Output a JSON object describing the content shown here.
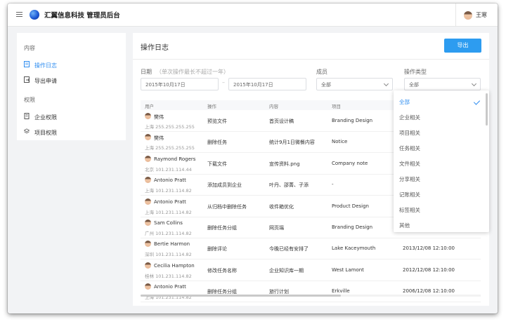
{
  "header": {
    "title": "汇翼信息科技 管理员后台",
    "user_name": "王寒",
    "menu_icon": "hamburger-icon",
    "logo": "globe-logo"
  },
  "sidebar": {
    "section_content": "内容",
    "section_permission": "权限",
    "items": [
      {
        "label": "操作日志",
        "icon": "document-icon",
        "active": true
      },
      {
        "label": "导出申请",
        "icon": "export-icon",
        "active": false
      },
      {
        "label": "企业权限",
        "icon": "building-icon",
        "active": false
      },
      {
        "label": "项目权限",
        "icon": "layers-icon",
        "active": false
      }
    ]
  },
  "main": {
    "title": "操作日志",
    "export_label": "导出"
  },
  "filters": {
    "date_label": "日期",
    "date_hint": "（单次操作最长不超过一年）",
    "date_start": "2015年10月17日",
    "date_separator": "–",
    "date_end": "2015年10月17日",
    "member_label": "成员",
    "member_value": "全部",
    "optype_label": "操作类型",
    "optype_value": "全部"
  },
  "table": {
    "columns": [
      "用户",
      "操作",
      "内容",
      "项目"
    ],
    "rows": [
      {
        "name": "樊伟",
        "location": "上海 255.255.255.255",
        "action": "预览文件",
        "content": "首页设计稿",
        "project": "Branding Design",
        "time": ""
      },
      {
        "name": "樊伟",
        "location": "上海 255.255.255.255",
        "action": "删除任务",
        "content": "统计9月1日微餐内容",
        "project": "Notice",
        "time": ""
      },
      {
        "name": "Raymond Rogers",
        "location": "北京 101.231.114.44",
        "action": "下载文件",
        "content": "宣传资料.png",
        "project": "Company note",
        "time": ""
      },
      {
        "name": "Antonio Pratt",
        "location": "上海 101.231.114.82",
        "action": "添加成员到企业",
        "content": "叶丹、邵菁、子添",
        "project": "-",
        "time": ""
      },
      {
        "name": "Antonio Pratt",
        "location": "上海 101.231.114.82",
        "action": "从归档中删除任务",
        "content": "收件箱优化",
        "project": "Product Design",
        "time": ""
      },
      {
        "name": "Sam Collins",
        "location": "广州 101.231.114.82",
        "action": "删除任务分组",
        "content": "网页端",
        "project": "Branding Design",
        "time": ""
      },
      {
        "name": "Bertie Harmon",
        "location": "深圳 101.231.114.82",
        "action": "删除评论",
        "content": "今晚已经有安排了",
        "project": "Lake Kaceymouth",
        "time": "2013/12/08 12:10:00"
      },
      {
        "name": "Cecilia Hampton",
        "location": "桂林 101.231.114.82",
        "action": "修改任务名称",
        "content": "企业知识库一期",
        "project": "West Lamont",
        "time": "2012/12/08 12:10:00"
      },
      {
        "name": "Antonio Pratt",
        "location": "上海 101.231.114.82",
        "action": "删除任务分组",
        "content": "旅行计划",
        "project": "Erkville",
        "time": "2006/12/08 12:10:00"
      }
    ]
  },
  "dropdown": {
    "selected": "全部",
    "options": [
      "全部",
      "企业相关",
      "项目相关",
      "任务相关",
      "文件相关",
      "分享相关",
      "记账相关",
      "标签相关",
      "其他"
    ]
  },
  "colors": {
    "accent": "#2d8cf0",
    "button": "#2d9cf0",
    "background": "#f2f3f5"
  }
}
